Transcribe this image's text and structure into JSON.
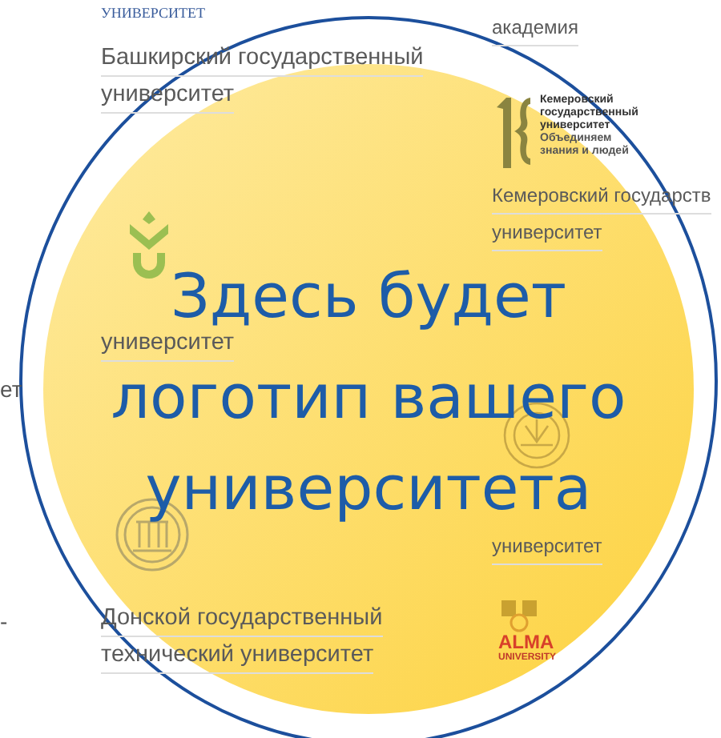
{
  "edge_fragments": [
    "ет",
    "-"
  ],
  "left_column": [
    {
      "kind": "logo-text",
      "text": "УНИВЕРСИТЕТ"
    },
    {
      "kind": "link",
      "lines": [
        "Башкирский государственный",
        "университет"
      ]
    },
    {
      "kind": "crest"
    },
    {
      "kind": "link",
      "lines": [
        "университет"
      ]
    },
    {
      "kind": "seal"
    },
    {
      "kind": "link",
      "lines": [
        "Донской государственный",
        "технический университет"
      ]
    }
  ],
  "right_column": [
    {
      "kind": "link",
      "lines": [
        "академия"
      ]
    },
    {
      "kind": "logo-kemerovo",
      "lines": [
        "Кемеровский",
        "государственный",
        "университет",
        "Объединяем",
        "знания и людей"
      ]
    },
    {
      "kind": "link",
      "lines": [
        "Кемеровский государств",
        "университет"
      ]
    },
    {
      "kind": "sunburst"
    },
    {
      "kind": "link",
      "lines": [
        "университет"
      ]
    },
    {
      "kind": "logo-alma",
      "lines": [
        "ALMA",
        "UNIVERSITY"
      ]
    }
  ],
  "promo": {
    "headline": [
      "Здесь будет",
      "логотип вашего",
      "университета"
    ]
  }
}
